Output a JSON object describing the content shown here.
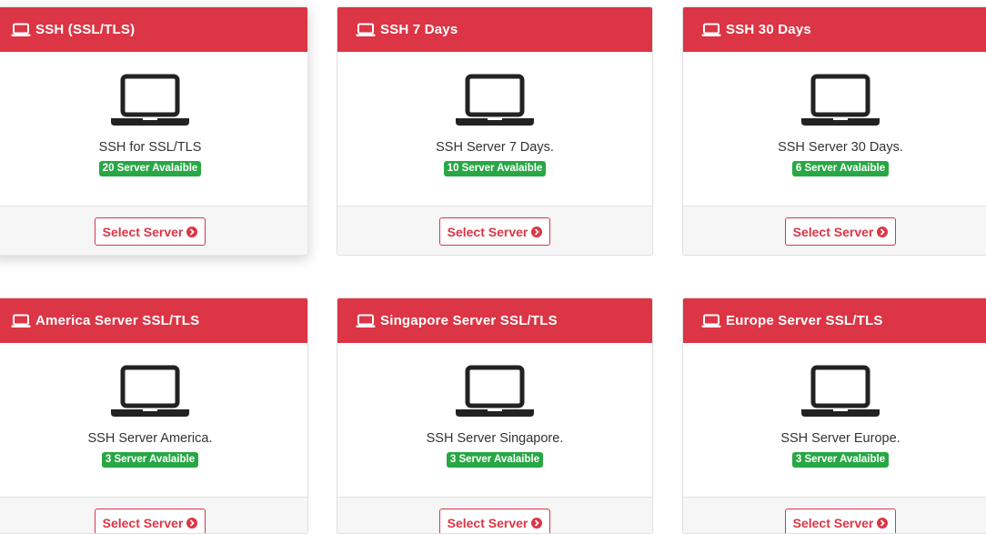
{
  "colors": {
    "header": "#dc3545",
    "badge": "#28a745",
    "button_border": "#dc3545"
  },
  "icons": {
    "header": "laptop-icon",
    "body": "laptop-icon",
    "button": "circle-arrow-right-icon"
  },
  "cards": [
    {
      "title": "SSH (SSL/TLS)",
      "description": "SSH for SSL/TLS",
      "badge": "20 Server Avalaible",
      "button": "Select Server"
    },
    {
      "title": "SSH 7 Days",
      "description": "SSH Server 7 Days.",
      "badge": "10 Server Avalaible",
      "button": "Select Server"
    },
    {
      "title": "SSH 30 Days",
      "description": "SSH Server 30 Days.",
      "badge": "6 Server Avalaible",
      "button": "Select Server"
    },
    {
      "title": "America Server SSL/TLS",
      "description": "SSH Server America.",
      "badge": "3 Server Avalaible",
      "button": "Select Server"
    },
    {
      "title": "Singapore Server SSL/TLS",
      "description": "SSH Server Singapore.",
      "badge": "3 Server Avalaible",
      "button": "Select Server"
    },
    {
      "title": "Europe Server SSL/TLS",
      "description": "SSH Server Europe.",
      "badge": "3 Server Avalaible",
      "button": "Select Server"
    }
  ]
}
